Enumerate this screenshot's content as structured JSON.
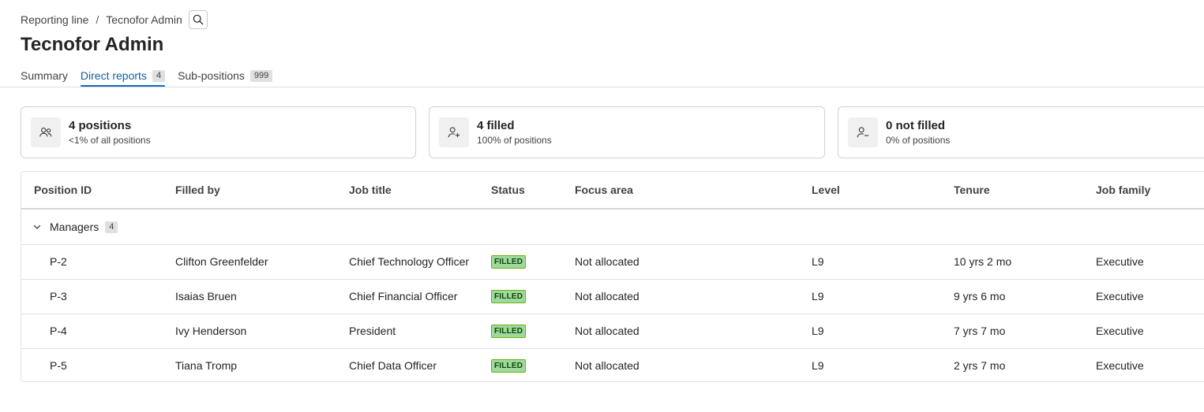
{
  "breadcrumb": {
    "parent": "Reporting line",
    "separator": "/",
    "current": "Tecnofor Admin"
  },
  "page_title": "Tecnofor Admin",
  "tabs": [
    {
      "label": "Summary",
      "count": null,
      "active": false
    },
    {
      "label": "Direct reports",
      "count": "4",
      "active": true
    },
    {
      "label": "Sub-positions",
      "count": "999",
      "active": false
    }
  ],
  "stats": [
    {
      "value": "4 positions",
      "sub": "<1% of all positions",
      "icon": "people-icon"
    },
    {
      "value": "4 filled",
      "sub": "100% of positions",
      "icon": "person-add-icon"
    },
    {
      "value": "0 not filled",
      "sub": "0% of positions",
      "icon": "person-remove-icon"
    }
  ],
  "table": {
    "columns": [
      "Position ID",
      "Filled by",
      "Job title",
      "Status",
      "Focus area",
      "Level",
      "Tenure",
      "Job family"
    ],
    "group": {
      "label": "Managers",
      "count": "4"
    },
    "rows": [
      {
        "id": "P-2",
        "filled_by": "Clifton Greenfelder",
        "title": "Chief Technology Officer",
        "status": "FILLED",
        "focus": "Not allocated",
        "level": "L9",
        "tenure": "10 yrs 2 mo",
        "family": "Executive"
      },
      {
        "id": "P-3",
        "filled_by": "Isaias Bruen",
        "title": "Chief Financial Officer",
        "status": "FILLED",
        "focus": "Not allocated",
        "level": "L9",
        "tenure": "9 yrs 6 mo",
        "family": "Executive"
      },
      {
        "id": "P-4",
        "filled_by": "Ivy Henderson",
        "title": "President",
        "status": "FILLED",
        "focus": "Not allocated",
        "level": "L9",
        "tenure": "7 yrs 7 mo",
        "family": "Executive"
      },
      {
        "id": "P-5",
        "filled_by": "Tiana Tromp",
        "title": "Chief Data Officer",
        "status": "FILLED",
        "focus": "Not allocated",
        "level": "L9",
        "tenure": "2 yrs 7 mo",
        "family": "Executive"
      }
    ]
  },
  "colors": {
    "accent": "#0f6cbd",
    "filled_badge_bg": "#9fd89f",
    "filled_badge_text": "#0e4700"
  }
}
